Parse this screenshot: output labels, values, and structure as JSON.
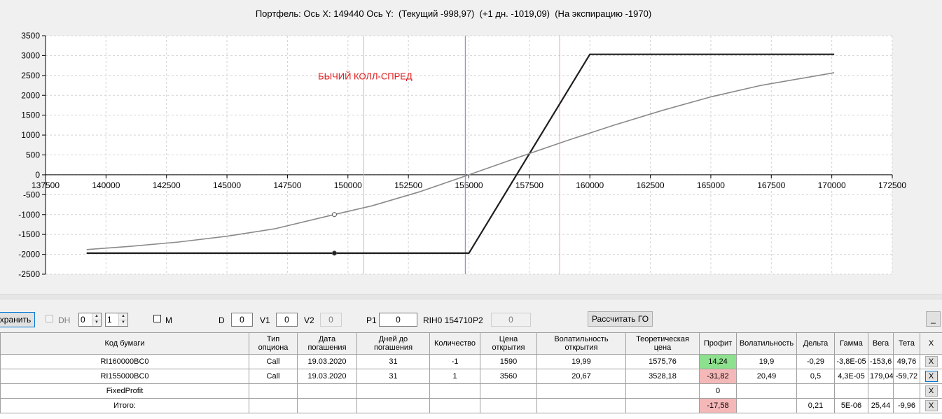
{
  "chart": {
    "title": "Портфель: Ось X: 149440 Ось Y:  (Текущий -998,97)  (+1 дн. -1019,09)  (На экспирацию -1970)",
    "annotation": "БЫЧИЙ КОЛЛ-СПРЕД",
    "annotation_color": "#e31a1c",
    "expiry_color": "#1f1f1f",
    "current_color": "#8a8a8a",
    "bound_color": "#f4a3a8",
    "cursor_color": "#7580b8"
  },
  "chart_data": {
    "type": "line",
    "xlim": [
      137500,
      172500
    ],
    "ylim": [
      -2500,
      3500
    ],
    "x_ticks": [
      "137500",
      "140000",
      "142500",
      "145000",
      "147500",
      "150000",
      "152500",
      "155000",
      "157500",
      "160000",
      "162500",
      "165000",
      "167500",
      "170000",
      "172500"
    ],
    "y_ticks": [
      "3500",
      "3000",
      "2500",
      "2000",
      "1500",
      "1000",
      "500",
      "0",
      "-500",
      "-1000",
      "-1500",
      "-2000",
      "-2500"
    ],
    "grid": true,
    "series": [
      {
        "name": "expiry",
        "x": [
          139200,
          155000,
          160000,
          170100
        ],
        "y": [
          -1970,
          -1970,
          3030,
          3030
        ]
      },
      {
        "name": "current",
        "x": [
          139200,
          141000,
          143000,
          145000,
          147000,
          149440,
          151000,
          153000,
          155000,
          157000,
          159000,
          161000,
          163000,
          165000,
          167000,
          170100
        ],
        "y": [
          -1880,
          -1800,
          -1690,
          -1545,
          -1355,
          -999,
          -780,
          -420,
          0,
          430,
          850,
          1250,
          1620,
          1960,
          2240,
          2570
        ]
      }
    ],
    "markers": [
      {
        "x": 149440,
        "y": -1970
      },
      {
        "x": 149440,
        "y": -999
      }
    ],
    "vlines": [
      {
        "x": 150650,
        "kind": "bound"
      },
      {
        "x": 154850,
        "kind": "cursor"
      },
      {
        "x": 158750,
        "kind": "bound"
      }
    ],
    "annotation_pos": {
      "x": 150500,
      "y": 2400
    }
  },
  "toolbar": {
    "save_label": "хранить",
    "dh_label": "DH",
    "spin1_value": "0",
    "spin2_value": "1",
    "m_label": "M",
    "d_label": "D",
    "d_value": "0",
    "v1_label": "V1",
    "v1_value": "0",
    "v2_label": "V2",
    "v2_value": "0",
    "p1_label": "P1",
    "p1_value": "0",
    "instrument_text": "RIH0 154710",
    "p2_label": "P2",
    "p2_value": "0",
    "calc_label": "Рассчитать ГО",
    "minimize_label": "_"
  },
  "table": {
    "headers": [
      "Код бумаги",
      "Тип опциона",
      "Дата погашения",
      "Дней до погашения",
      "Количество",
      "Цена открытия",
      "Волатильность открытия",
      "Теоретическая цена",
      "Профит",
      "Волатильность",
      "Дельта",
      "Гамма",
      "Вега",
      "Тета",
      "X"
    ],
    "rows": [
      [
        "RI160000BC0",
        "Call",
        "19.03.2020",
        "31",
        "-1",
        "1590",
        "19,99",
        "1575,76",
        "14,24",
        "19,9",
        "-0,29",
        "-3,8E-05",
        "-153,6",
        "49,76",
        "X"
      ],
      [
        "RI155000BC0",
        "Call",
        "19.03.2020",
        "31",
        "1",
        "3560",
        "20,67",
        "3528,18",
        "-31,82",
        "20,49",
        "0,5",
        "4,3E-05",
        "179,04",
        "-59,72",
        "X"
      ],
      [
        "FixedProfit",
        "",
        "",
        "",
        "",
        "",
        "",
        "",
        "0",
        "",
        "",
        "",
        "",
        "",
        "X"
      ],
      [
        "Итого:",
        "",
        "",
        "",
        "",
        "",
        "",
        "",
        "-17,58",
        "",
        "0,21",
        "5E-06",
        "25,44",
        "-9,96",
        "X"
      ]
    ],
    "profit_colors": {
      "positive": "#8de08d",
      "negative": "#f5b8b8"
    }
  }
}
